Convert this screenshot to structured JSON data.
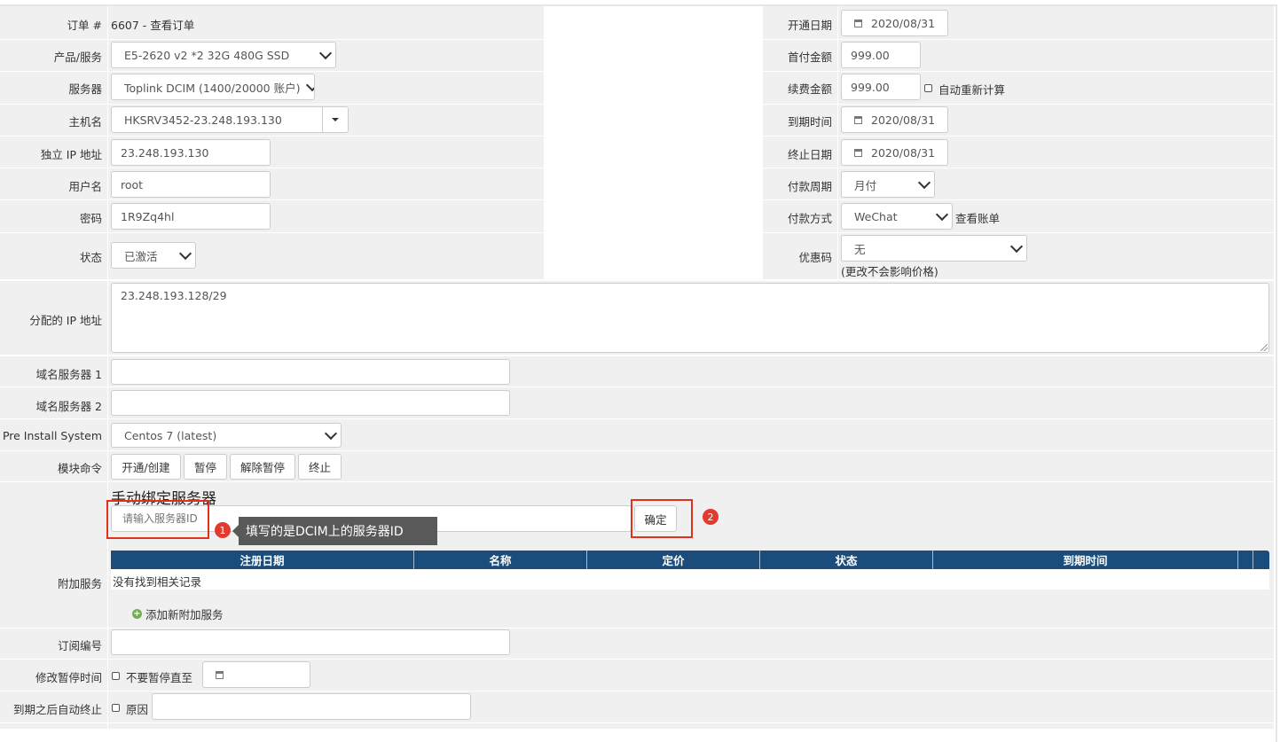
{
  "order": {
    "label": "订单 #",
    "value": "6607 - 查看订单"
  },
  "product": {
    "label": "产品/服务",
    "value": "E5-2620 v2 *2 32G 480G SSD"
  },
  "server": {
    "label": "服务器",
    "value": "Toplink DCIM (1400/20000 账户)"
  },
  "hostname": {
    "label": "主机名",
    "value": "HKSRV3452-23.248.193.130"
  },
  "dedicated_ip": {
    "label": "独立 IP 地址",
    "value": "23.248.193.130"
  },
  "username": {
    "label": "用户名",
    "value": "root"
  },
  "password": {
    "label": "密码",
    "value": "1R9Zq4hl"
  },
  "status": {
    "label": "状态",
    "value": "已激活"
  },
  "reg_date": {
    "label": "开通日期",
    "value": "2020/08/31"
  },
  "first_amount": {
    "label": "首付金额",
    "value": "999.00"
  },
  "recurring_amount": {
    "label": "续费金额",
    "value": "999.00",
    "auto_recalc": "自动重新计算"
  },
  "next_due": {
    "label": "到期时间",
    "value": "2020/08/31"
  },
  "termination_date": {
    "label": "终止日期",
    "value": "2020/08/31"
  },
  "billing_cycle": {
    "label": "付款周期",
    "value": "月付"
  },
  "payment_method": {
    "label": "付款方式",
    "value": "WeChat",
    "link": "查看账单"
  },
  "promo": {
    "label": "优惠码",
    "value": "无",
    "note": "(更改不会影响价格)"
  },
  "assigned_ips": {
    "label": "分配的 IP 地址",
    "value": "23.248.193.128/29"
  },
  "ns1": {
    "label": "域名服务器 1",
    "value": ""
  },
  "ns2": {
    "label": "域名服务器 2",
    "value": ""
  },
  "os": {
    "label": "Pre Install System",
    "value": "Centos 7 (latest)"
  },
  "module": {
    "label": "模块命令",
    "buttons": [
      "开通/创建",
      "暂停",
      "解除暂停",
      "终止"
    ]
  },
  "manual_bind": {
    "title": "手动绑定服务器",
    "placeholder": "请输入服务器ID",
    "confirm": "确定",
    "badge1": "1",
    "badge2": "2",
    "tooltip": "填写的是DCIM上的服务器ID"
  },
  "addons": {
    "label": "附加服务",
    "columns": [
      "注册日期",
      "名称",
      "定价",
      "状态",
      "到期时间"
    ],
    "empty": "没有找到相关记录",
    "add_link": "添加新附加服务"
  },
  "subscription": {
    "label": "订阅编号",
    "value": ""
  },
  "suspend_until": {
    "label": "修改暂停时间",
    "checkbox": "不要暂停直至"
  },
  "auto_terminate": {
    "label": "到期之后自动终止",
    "checkbox": "原因"
  },
  "colors": {
    "table_header": "#1a4d7c",
    "highlight": "#e0301e",
    "tooltip_bg": "#595959"
  }
}
